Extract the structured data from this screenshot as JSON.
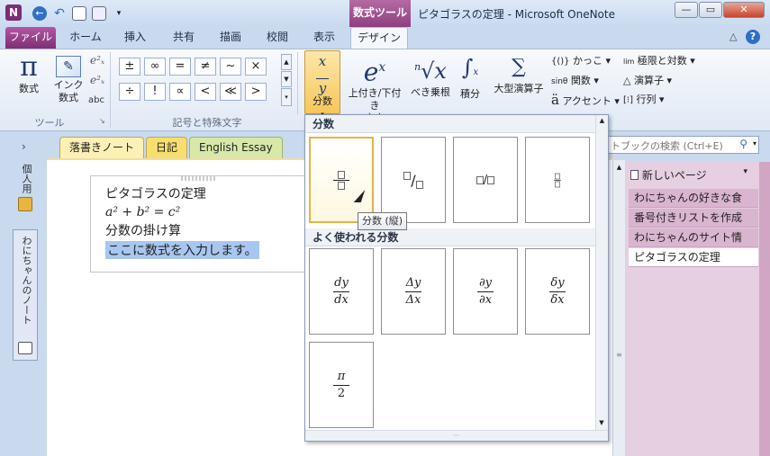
{
  "title_bar": {
    "context_tool": "数式ツール",
    "window_title": "ピタゴラスの定理 - Microsoft OneNote",
    "app_letter": "N"
  },
  "tabs": [
    "ファイル",
    "ホーム",
    "挿入",
    "共有",
    "描画",
    "校閲",
    "表示",
    "デザイン"
  ],
  "ribbon": {
    "tools": {
      "equation": "数式",
      "ink_equation": "インク\n数式",
      "group_label": "ツール",
      "abc": "abc"
    },
    "symbols": {
      "cells": [
        "±",
        "∞",
        "=",
        "≠",
        "~",
        "×",
        "÷",
        "!",
        "∝",
        "<",
        "≪",
        ">"
      ],
      "group_label": "記号と特殊文字"
    },
    "structures": {
      "fraction": "分数",
      "script": "上付き/下付き\n文字",
      "radical": "べき乗根",
      "integral": "積分",
      "large_operator": "大型演算子",
      "bracket": "かっこ",
      "function": "関数",
      "accent": "アクセント",
      "limit_log": "極限と対数",
      "operator": "演算子",
      "matrix": "行列"
    }
  },
  "notebook_tabs": [
    "落書きノート",
    "日記",
    "English Essay"
  ],
  "search": {
    "placeholder": "トブックの検索 (Ctrl+E)"
  },
  "left_nav": {
    "personal": "個人用",
    "notebook": "わにちゃんのノート"
  },
  "note": {
    "title": "ピタゴラスの定理",
    "equation": "a² + b² = c²",
    "line3": "分数の掛け算",
    "placeholder_line": "ここに数式を入力します。"
  },
  "pages": {
    "new_page": "新しいページ",
    "items": [
      "わにちゃんの好きな食",
      "番号付きリストを作成",
      "わにちゃんのサイト情",
      "ピタゴラスの定理"
    ]
  },
  "dropdown": {
    "section1": "分数",
    "section2": "よく使われる分数",
    "common": [
      {
        "num": "dy",
        "den": "dx"
      },
      {
        "num": "Δy",
        "den": "Δx"
      },
      {
        "num": "∂y",
        "den": "∂x"
      },
      {
        "num": "δy",
        "den": "δx"
      },
      {
        "num": "π",
        "den": "2"
      }
    ],
    "tooltip": "分数 (縦)"
  }
}
